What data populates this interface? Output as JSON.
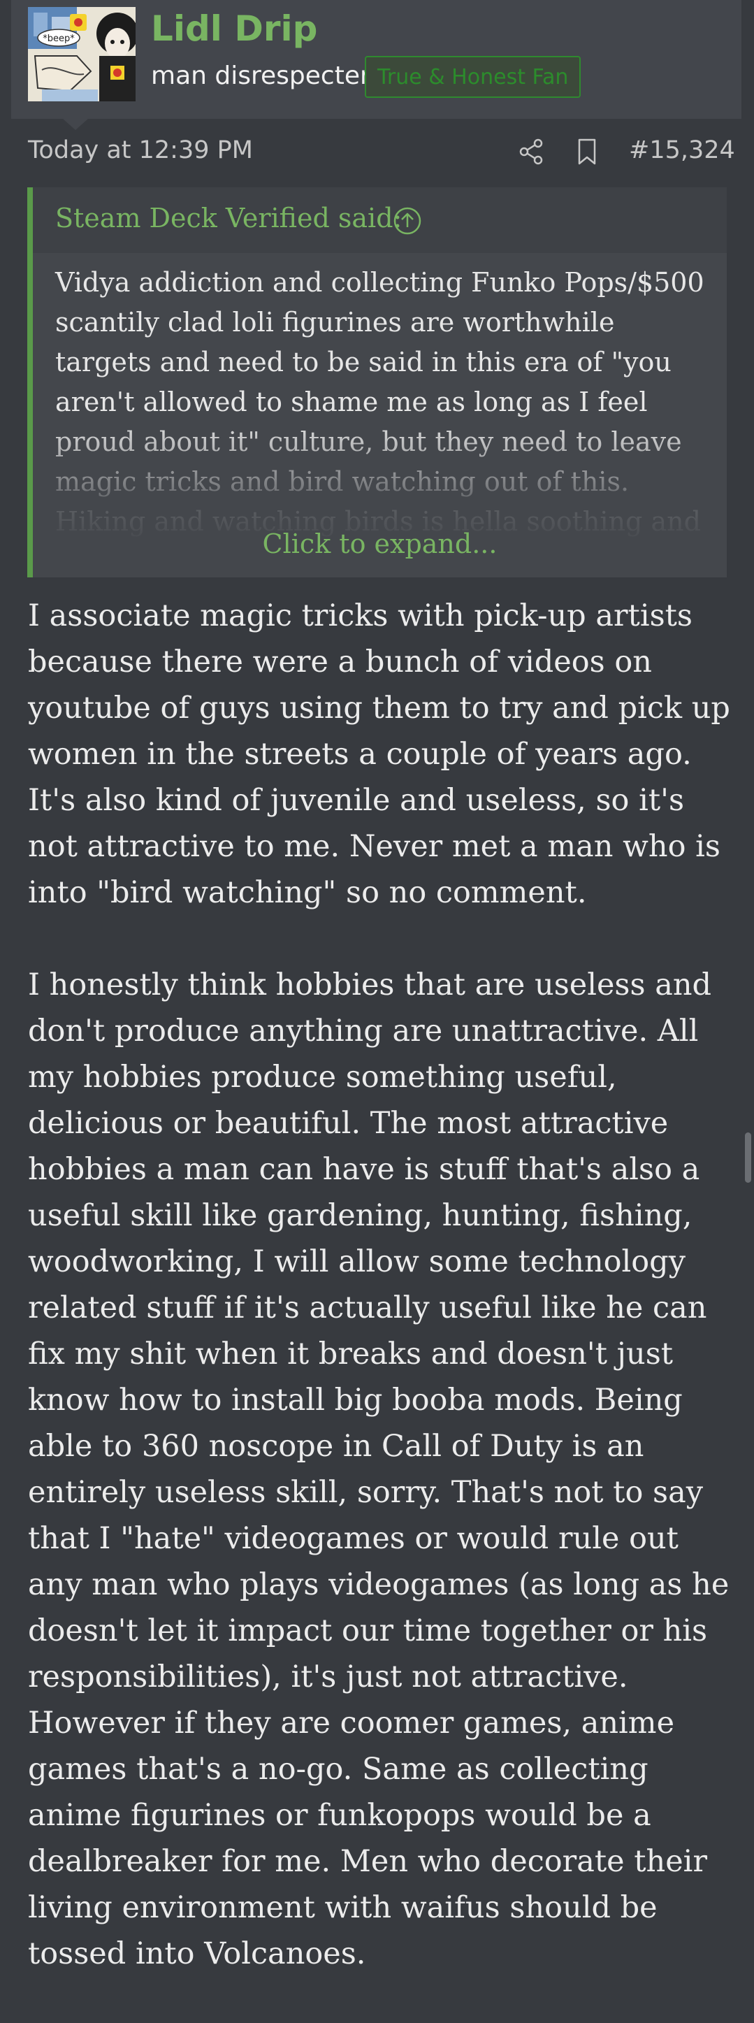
{
  "user": {
    "name": "Lidl Drip",
    "title": "man disrespecter",
    "banner": "True & Honest Fan",
    "avatar_text": "*beep*"
  },
  "post": {
    "date": "Today at 12:39 PM",
    "number": "#15,324"
  },
  "quote": {
    "attribution": "Steam Deck Verified said:",
    "text": "Vidya addiction and collecting Funko Pops/$500 scantily clad loli figurines are worthwhile targets and need to be said in this era of \"you aren't allowed to shame me as long as I feel proud about it\" culture, but they need to leave magic tricks and bird watching out of this. Hiking and watching birds is hella soothing and the male lead of A Quiet",
    "expand_label": "Click to expand..."
  },
  "body": {
    "paragraph_1": "I associate magic tricks with pick-up artists because there were a bunch of videos on youtube of guys using them to try and pick up women in the streets a couple of years ago. It's also kind of juvenile and useless, so it's not attractive to me. Never met a man who is into \"bird watching\" so no comment.",
    "paragraph_2": "I honestly think hobbies that are useless and don't produce anything are unattractive. All my hobbies produce something useful, delicious or beautiful. The most attractive hobbies a man can have is stuff that's also a useful skill like gardening, hunting, fishing, woodworking, I will allow some technology related stuff if it's actually useful like he can fix my shit when it breaks and doesn't just know how to install big booba mods. Being able to 360 noscope in Call of Duty is an entirely useless skill, sorry. That's not to say that I \"hate\" videogames or would rule out any man who plays videogames (as long as he doesn't let it impact our time together or his responsibilities), it's just not attractive. However if they are coomer games, anime games that's a no-go. Same as collecting anime figurines or funkopops would be a dealbreaker for me. Men who decorate their living environment with waifus should be tossed into Volcanoes."
  },
  "icons": {
    "share": "share-icon",
    "bookmark": "bookmark-icon",
    "quote_up": "arrow-up-circle-icon"
  },
  "colors": {
    "background": "#373a3f",
    "header": "#43464c",
    "accent_green": "#79b562",
    "banner_green": "#2c8c2c",
    "quote_bg": "#44474c"
  }
}
